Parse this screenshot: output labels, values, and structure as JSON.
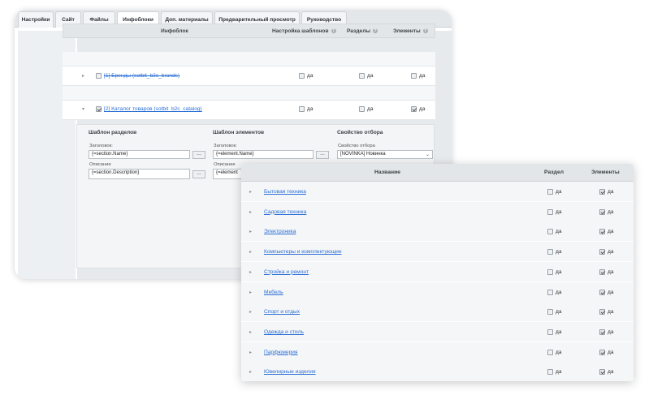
{
  "tabs": [
    {
      "label": "Настройки",
      "active": false
    },
    {
      "label": "Сайт",
      "active": false
    },
    {
      "label": "Файлы",
      "active": false
    },
    {
      "label": "Инфоблоки",
      "active": true
    },
    {
      "label": "Доп. материалы",
      "active": false
    },
    {
      "label": "Предварительный просмотр",
      "active": false
    },
    {
      "label": "Руководство",
      "active": false
    }
  ],
  "infoblocks_table": {
    "headers": {
      "infoblock": "Инфоблок",
      "templates": "Настройка шаблонов",
      "sections": "Разделы",
      "elements": "Элементы"
    },
    "help_icon": "?",
    "rows": [
      {
        "name": "[1] Бренды (sotbit_b2c_brands)",
        "expanded": false,
        "checked": false,
        "struck": true,
        "templates": false,
        "sections": false,
        "elements": false,
        "yes": "да"
      },
      {
        "name": "[2] Каталог товаров (sotbit_b2c_catalog)",
        "expanded": true,
        "checked": true,
        "struck": false,
        "templates": false,
        "sections": false,
        "elements": true,
        "yes": "да"
      }
    ]
  },
  "template_settings": {
    "section_template_title": "Шаблон разделов",
    "element_template_title": "Шаблон элементов",
    "filter_property_title": "Свойство отбора",
    "section_title_label": "Заголовок",
    "section_title_value": "{=section.Name}",
    "section_desc_label": "Описание",
    "section_desc_value": "{=section.Description}",
    "element_title_label": "Заголовок",
    "element_title_value": "{=element.Name}",
    "element_desc_label": "Описание",
    "element_desc_value": "{=element",
    "filter_label": "Свойство отбора",
    "filter_value": "[NOVINKA] Новинка",
    "dots_label": "...",
    "select_arrow": "⌄"
  },
  "sections_table": {
    "headers": {
      "name": "Название",
      "section": "Раздел",
      "elements": "Элементы"
    },
    "yes": "да",
    "rows": [
      {
        "name": "Бытовая техника",
        "section": false,
        "elements": true
      },
      {
        "name": "Садовая техника",
        "section": false,
        "elements": true
      },
      {
        "name": "Электроника",
        "section": false,
        "elements": true
      },
      {
        "name": "Компьютеры и комплектующие",
        "section": false,
        "elements": true
      },
      {
        "name": "Стройка и ремонт",
        "section": false,
        "elements": true
      },
      {
        "name": "Мебель",
        "section": false,
        "elements": true
      },
      {
        "name": "Спорт и отдых",
        "section": false,
        "elements": true
      },
      {
        "name": "Одежда и стиль",
        "section": false,
        "elements": true
      },
      {
        "name": "Парфюмерия",
        "section": false,
        "elements": true
      },
      {
        "name": "Ювелирные изделия",
        "section": false,
        "elements": true
      }
    ]
  },
  "icons": {
    "expand": "chevron-right-icon",
    "collapse": "chevron-down-icon",
    "help": "help-icon"
  }
}
